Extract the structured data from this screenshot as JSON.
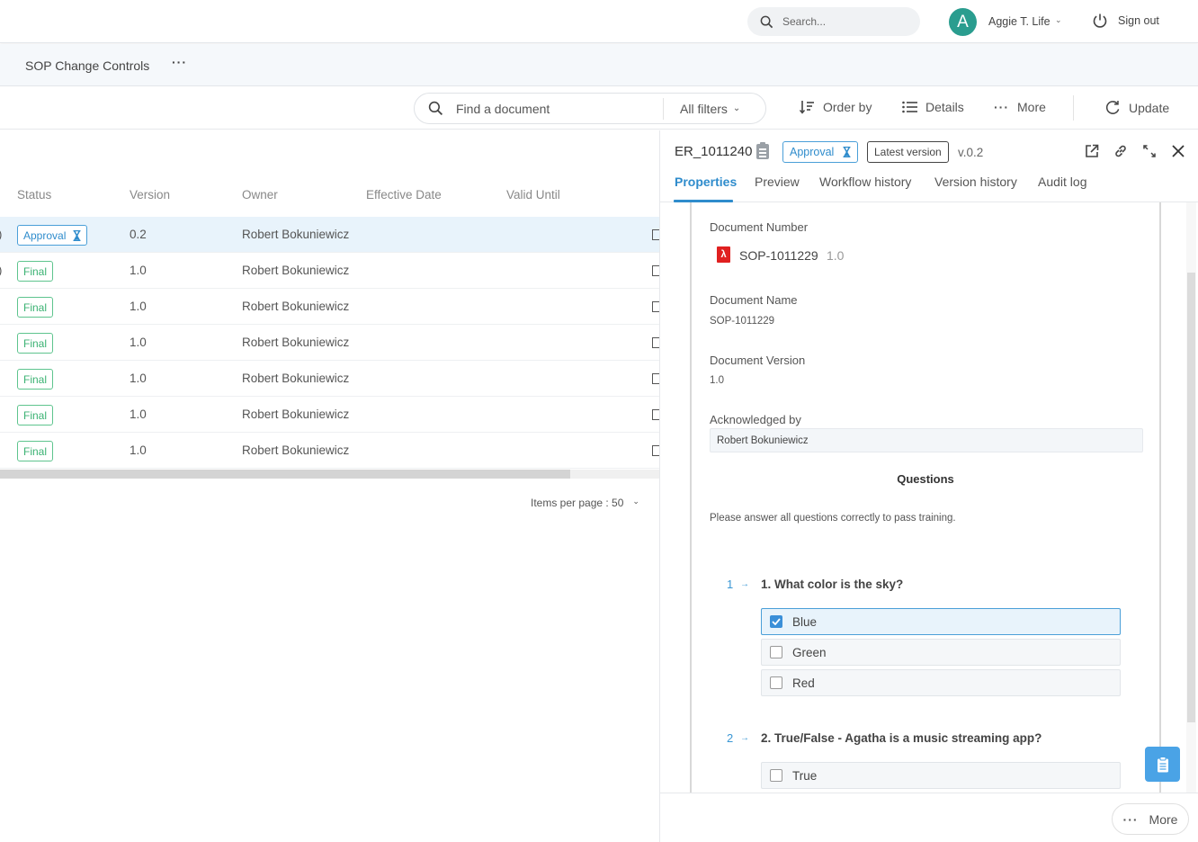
{
  "topbar": {
    "search_placeholder": "Search...",
    "user_initial": "A",
    "user_name": "Aggie T. Life",
    "signout_label": "Sign out",
    "avatar_color": "#2a9d8f"
  },
  "subbar": {
    "title": "SOP Change Controls",
    "more_label": "···"
  },
  "toolbar": {
    "find_placeholder": "Find a document",
    "filters_label": "All filters",
    "order_label": "Order by",
    "details_label": "Details",
    "more_label": "More",
    "update_label": "Update"
  },
  "table": {
    "columns": [
      "Status",
      "Version",
      "Owner",
      "Effective Date",
      "Valid Until"
    ],
    "rows": [
      {
        "lead": ")",
        "status": "Approval",
        "version": "0.2",
        "owner": "Robert Bokuniewicz",
        "effective": "",
        "valid": "",
        "selected": true
      },
      {
        "lead": ")",
        "status": "Final",
        "version": "1.0",
        "owner": "Robert Bokuniewicz",
        "effective": "",
        "valid": ""
      },
      {
        "lead": "",
        "status": "Final",
        "version": "1.0",
        "owner": "Robert Bokuniewicz",
        "effective": "",
        "valid": ""
      },
      {
        "lead": "",
        "status": "Final",
        "version": "1.0",
        "owner": "Robert Bokuniewicz",
        "effective": "",
        "valid": ""
      },
      {
        "lead": "",
        "status": "Final",
        "version": "1.0",
        "owner": "Robert Bokuniewicz",
        "effective": "",
        "valid": ""
      },
      {
        "lead": "",
        "status": "Final",
        "version": "1.0",
        "owner": "Robert Bokuniewicz",
        "effective": "",
        "valid": ""
      },
      {
        "lead": "",
        "status": "Final",
        "version": "1.0",
        "owner": "Robert Bokuniewicz",
        "effective": "",
        "valid": ""
      }
    ],
    "items_per_page_label": "Items per page : 50"
  },
  "panel": {
    "title": "ER_1011240",
    "status_badge": "Approval",
    "latest_badge": "Latest version",
    "version": "v.0.2",
    "tabs": [
      "Properties",
      "Preview",
      "Workflow history",
      "Version history",
      "Audit log"
    ],
    "active_tab": "Properties",
    "fields": {
      "doc_number_label": "Document Number",
      "doc_number": "SOP-1011229",
      "doc_number_version": "1.0",
      "doc_name_label": "Document Name",
      "doc_name": "SOP-1011229",
      "doc_version_label": "Document Version",
      "doc_version": "1.0",
      "ack_label": "Acknowledged by",
      "ack_value": "Robert Bokuniewicz"
    },
    "questions_title": "Questions",
    "questions_intro": "Please answer all questions correctly to pass training.",
    "questions": [
      {
        "num": "1",
        "text": "1.  What color is the sky?",
        "options": [
          {
            "label": "Blue",
            "checked": true
          },
          {
            "label": "Green",
            "checked": false
          },
          {
            "label": "Red",
            "checked": false
          }
        ]
      },
      {
        "num": "2",
        "text": "2.  True/False - Agatha is a music streaming app?",
        "options": [
          {
            "label": "True",
            "checked": false
          }
        ]
      }
    ],
    "footer_more": "More"
  },
  "colors": {
    "accent": "#2f8ccc",
    "final_green": "#3bb273",
    "pdf_red": "#e02020"
  }
}
